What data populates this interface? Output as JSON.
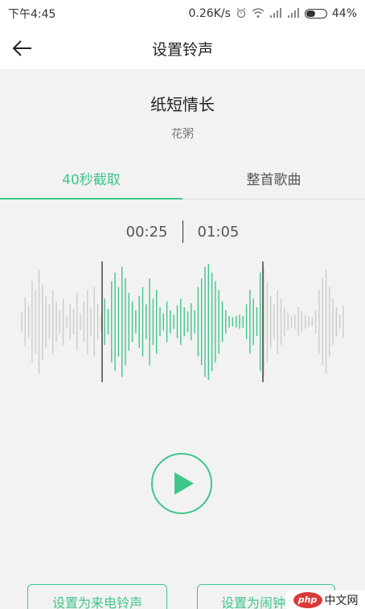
{
  "status_bar": {
    "time": "下午4:45",
    "network_speed": "0.26K/s",
    "battery_text": "44%",
    "battery_level": 0.44,
    "icons": [
      "alarm-icon",
      "wifi-icon",
      "signal-icon",
      "signal-icon"
    ]
  },
  "app_bar": {
    "title": "设置铃声",
    "back_icon": "arrow-left-icon"
  },
  "song": {
    "title": "纸短情长",
    "artist": "花粥"
  },
  "tabs": [
    {
      "label": "40秒截取",
      "active": true
    },
    {
      "label": "整首歌曲",
      "active": false
    }
  ],
  "clip": {
    "start_time": "00:25",
    "end_time": "01:05",
    "selection_start_fraction": 0.25,
    "selection_end_fraction": 0.75
  },
  "waveform": {
    "samples": [
      0.18,
      0.42,
      0.28,
      0.7,
      0.55,
      0.9,
      0.65,
      0.45,
      0.3,
      0.55,
      0.35,
      0.2,
      0.4,
      0.1,
      0.3,
      0.22,
      0.5,
      0.15,
      0.35,
      0.55,
      0.25,
      0.6,
      0.3,
      0.15,
      0.4,
      0.22,
      0.7,
      0.85,
      0.6,
      0.95,
      0.75,
      0.5,
      0.35,
      0.2,
      0.45,
      0.6,
      0.3,
      0.75,
      0.4,
      0.55,
      0.25,
      0.15,
      0.35,
      0.2,
      0.12,
      0.28,
      0.4,
      0.25,
      0.18,
      0.32,
      0.2,
      0.6,
      0.75,
      0.95,
      1.0,
      0.85,
      0.7,
      0.55,
      0.35,
      0.2,
      0.1,
      0.08,
      0.1,
      0.12,
      0.1,
      0.3,
      0.55,
      0.4,
      0.25,
      0.85,
      0.95,
      0.7,
      0.45,
      0.3,
      0.55,
      0.4,
      0.25,
      0.15,
      0.1,
      0.12,
      0.25,
      0.18,
      0.12,
      0.1,
      0.08,
      0.2,
      0.55,
      0.75,
      0.9,
      0.6,
      0.4,
      0.25,
      0.12,
      0.28
    ],
    "played_color": "#3fc68b",
    "unplayed_color": "#cccccc"
  },
  "player": {
    "play_icon": "play-icon"
  },
  "actions": {
    "set_ringtone": "设置为来电铃声",
    "set_alarm": "设置为闹钟铃声"
  },
  "colors": {
    "accent": "#3fc68b",
    "background": "#f2f2f2"
  },
  "watermark": {
    "logo_text": "php",
    "text": "中文网"
  }
}
